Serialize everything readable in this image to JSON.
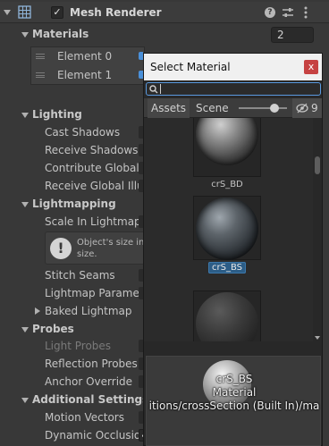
{
  "header": {
    "title": "Mesh Renderer",
    "enabled": true
  },
  "materials": {
    "label": "Materials",
    "count": "2",
    "elements": [
      "Element 0",
      "Element 1"
    ]
  },
  "lighting": {
    "label": "Lighting",
    "props": [
      "Cast Shadows",
      "Receive Shadows",
      "Contribute Global I",
      "Receive Global Illu"
    ]
  },
  "lightmapping": {
    "label": "Lightmapping",
    "scale_label": "Scale In Lightmap",
    "warning": [
      "Object's size in",
      "size."
    ],
    "stitch_label": "Stitch Seams",
    "params_label": "Lightmap Paramete",
    "baked_label": "Baked Lightmap"
  },
  "probes": {
    "label": "Probes",
    "props": [
      "Light Probes",
      "Reflection Probes",
      "Anchor Override"
    ]
  },
  "additional": {
    "label": "Additional Settings",
    "props": [
      "Motion Vectors",
      "Dynamic Occlusio"
    ]
  },
  "picker": {
    "title": "Select Material",
    "close": "x",
    "tabs": [
      "Assets",
      "Scene"
    ],
    "hidden_count": "9",
    "items": [
      {
        "label": "crS_BD",
        "selected": false
      },
      {
        "label": "crS_BS",
        "selected": true
      },
      {
        "label": "",
        "selected": false
      }
    ],
    "preview": {
      "name": "crS_BS",
      "type": "Material",
      "path": "itions/crossSection (Built In)/ma"
    }
  },
  "icons": [
    "mesh-renderer-icon",
    "help-icon",
    "preset-icon",
    "more-icon",
    "search-icon",
    "eye-off-icon",
    "warning-icon"
  ],
  "colors": {
    "selection": "#2c5d87",
    "focus": "#5a9ae0",
    "close": "#c64242"
  }
}
